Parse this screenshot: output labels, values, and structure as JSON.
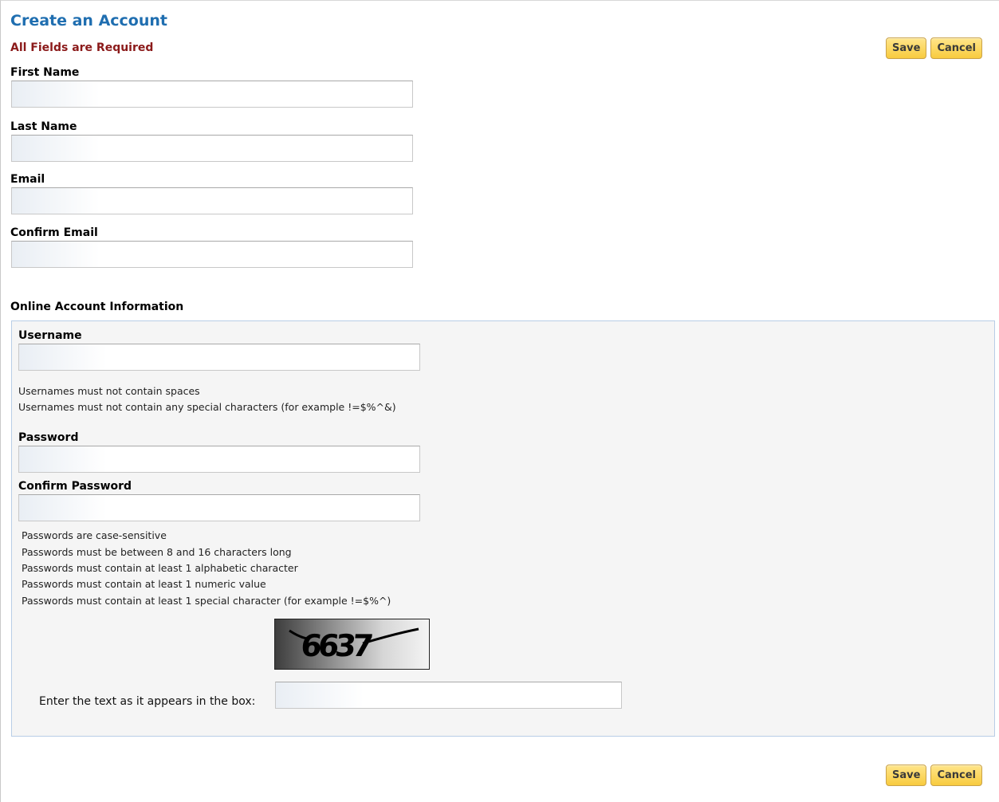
{
  "header": {
    "title": "Create an Account",
    "required_note": "All Fields are Required"
  },
  "actions": {
    "save_label": "Save",
    "cancel_label": "Cancel"
  },
  "contact": {
    "first_name": {
      "label": "First Name",
      "value": ""
    },
    "last_name": {
      "label": "Last Name",
      "value": ""
    },
    "email": {
      "label": "Email",
      "value": ""
    },
    "confirm_email": {
      "label": "Confirm Email",
      "value": ""
    }
  },
  "online_account": {
    "section_title": "Online Account Information",
    "username": {
      "label": "Username",
      "value": "",
      "hints": [
        "Usernames must not contain spaces",
        "Usernames must not contain any special characters (for example !=$%^&)"
      ]
    },
    "password": {
      "label": "Password",
      "value": ""
    },
    "confirm_password": {
      "label": "Confirm Password",
      "value": ""
    },
    "password_hints": [
      "Passwords are case-sensitive",
      "Passwords must be between 8 and 16 characters long",
      "Passwords must contain at least 1 alphabetic character",
      "Passwords must contain at least 1 numeric value",
      "Passwords must contain at least 1 special character (for example !=$%^)"
    ],
    "captcha": {
      "image_text": "6637",
      "prompt": "Enter the text as it appears in the box:",
      "value": ""
    }
  }
}
